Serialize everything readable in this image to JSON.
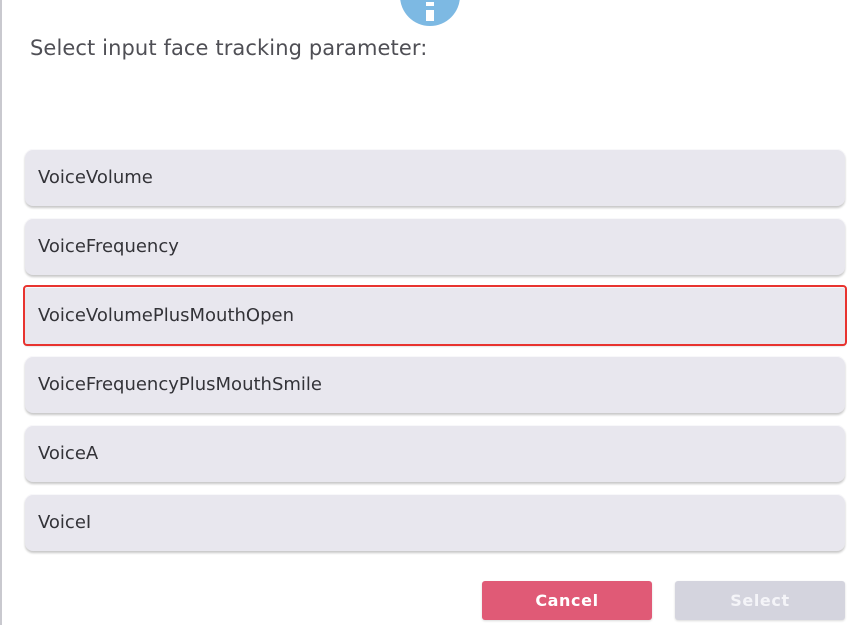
{
  "dialog": {
    "icon": "info-icon",
    "prompt": "Select input face tracking parameter:"
  },
  "options": [
    {
      "label": "VoiceVolume",
      "highlighted": false
    },
    {
      "label": "VoiceFrequency",
      "highlighted": false
    },
    {
      "label": "VoiceVolumePlusMouthOpen",
      "highlighted": true
    },
    {
      "label": "VoiceFrequencyPlusMouthSmile",
      "highlighted": false
    },
    {
      "label": "VoiceA",
      "highlighted": false
    },
    {
      "label": "VoiceI",
      "highlighted": false
    }
  ],
  "buttons": {
    "cancel_label": "Cancel",
    "select_label": "Select"
  },
  "colors": {
    "accent_cancel": "#e05a76",
    "select_disabled": "#d4d4de",
    "option_bg": "#e8e7ee",
    "highlight_outline": "#e8332f",
    "info_icon": "#7db9e3"
  }
}
